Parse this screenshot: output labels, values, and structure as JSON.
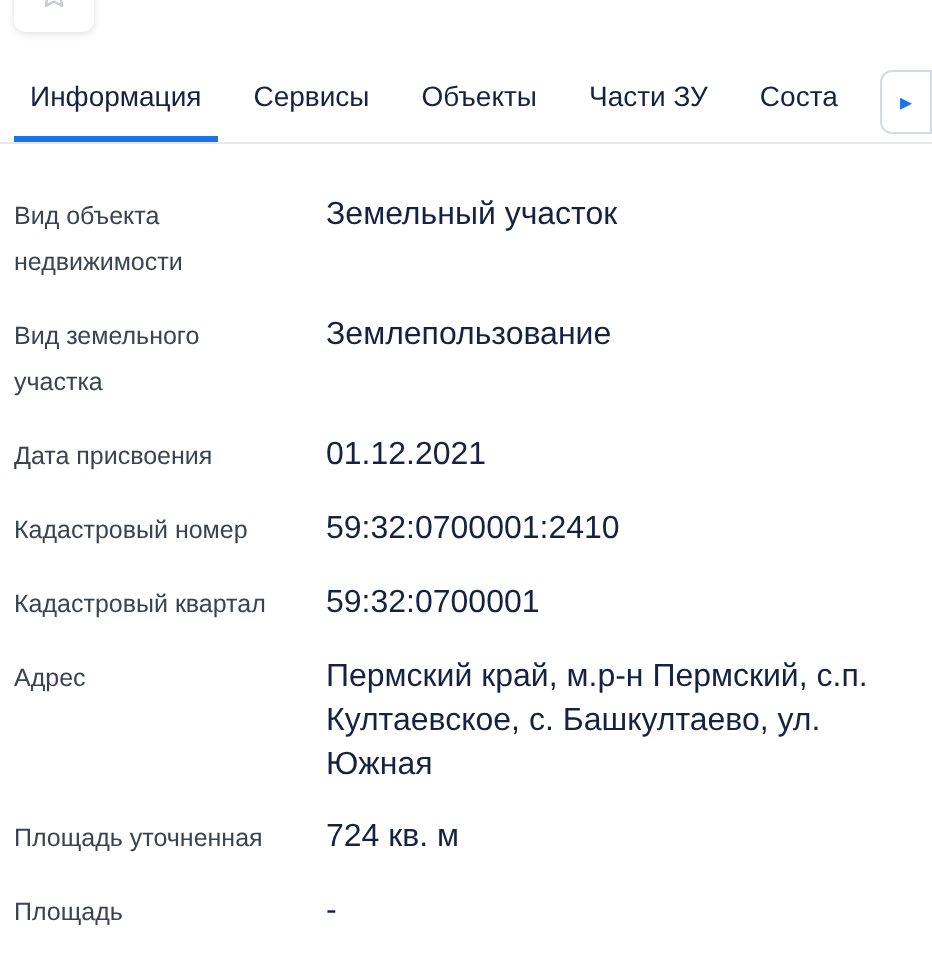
{
  "tabs": [
    {
      "label": "Информация",
      "selected": true
    },
    {
      "label": "Сервисы",
      "selected": false
    },
    {
      "label": "Объекты",
      "selected": false
    },
    {
      "label": "Части ЗУ",
      "selected": false
    },
    {
      "label": "Соста",
      "selected": false
    }
  ],
  "tabs_scroll_button": {
    "icon": "▸"
  },
  "details": [
    {
      "label": "Вид объекта недвижимости",
      "value": "Земельный участок"
    },
    {
      "label": "Вид земельного участка",
      "value": "Землепользование"
    },
    {
      "label": "Дата присвоения",
      "value": "01.12.2021"
    },
    {
      "label": "Кадастровый номер",
      "value": "59:32:0700001:2410"
    },
    {
      "label": "Кадастровый квартал",
      "value": "59:32:0700001"
    },
    {
      "label": "Адрес",
      "value": "Пермский край, м.р-н Пермский, с.п. Култаевское, с. Башкултаево, ул. Южная"
    },
    {
      "label": "Площадь уточненная",
      "value": "724 кв. м"
    },
    {
      "label": "Площадь",
      "value": "-"
    }
  ]
}
